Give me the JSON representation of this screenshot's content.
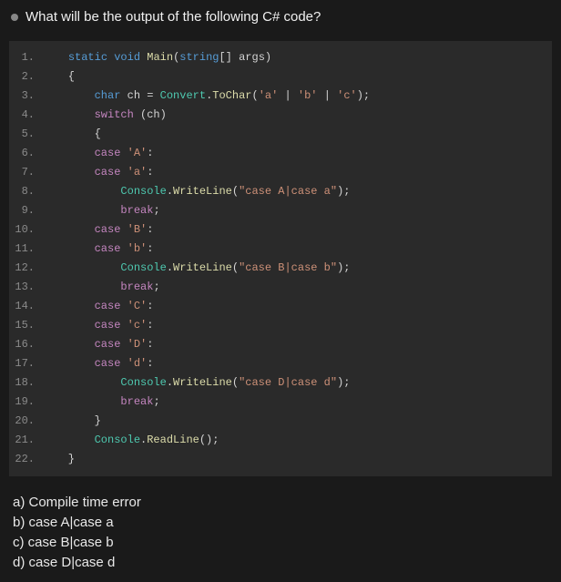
{
  "question": "What will be the output of the following C# code?",
  "code_lines": [
    {
      "n": "1.",
      "tokens": [
        {
          "t": "    "
        },
        {
          "t": "static",
          "c": "kw-mod"
        },
        {
          "t": " "
        },
        {
          "t": "void",
          "c": "kw-blue"
        },
        {
          "t": " "
        },
        {
          "t": "Main",
          "c": "fn"
        },
        {
          "t": "(",
          "c": "paren"
        },
        {
          "t": "string",
          "c": "kw-blue"
        },
        {
          "t": "[] "
        },
        {
          "t": "args",
          "c": "punct"
        },
        {
          "t": ")",
          "c": "paren"
        }
      ]
    },
    {
      "n": "2.",
      "tokens": [
        {
          "t": "    {"
        }
      ]
    },
    {
      "n": "3.",
      "tokens": [
        {
          "t": "        "
        },
        {
          "t": "char",
          "c": "kw-blue"
        },
        {
          "t": " ch = "
        },
        {
          "t": "Convert",
          "c": "type"
        },
        {
          "t": "."
        },
        {
          "t": "ToChar",
          "c": "fn"
        },
        {
          "t": "("
        },
        {
          "t": "'a'",
          "c": "str"
        },
        {
          "t": " | "
        },
        {
          "t": "'b'",
          "c": "str"
        },
        {
          "t": " | "
        },
        {
          "t": "'c'",
          "c": "str"
        },
        {
          "t": ");"
        }
      ]
    },
    {
      "n": "4.",
      "tokens": [
        {
          "t": "        "
        },
        {
          "t": "switch",
          "c": "kw-flow"
        },
        {
          "t": " (ch)"
        }
      ]
    },
    {
      "n": "5.",
      "tokens": [
        {
          "t": "        {"
        }
      ]
    },
    {
      "n": "6.",
      "tokens": [
        {
          "t": "        "
        },
        {
          "t": "case",
          "c": "kw-flow"
        },
        {
          "t": " "
        },
        {
          "t": "'A'",
          "c": "str"
        },
        {
          "t": ":"
        }
      ]
    },
    {
      "n": "7.",
      "tokens": [
        {
          "t": "        "
        },
        {
          "t": "case",
          "c": "kw-flow"
        },
        {
          "t": " "
        },
        {
          "t": "'a'",
          "c": "str"
        },
        {
          "t": ":"
        }
      ]
    },
    {
      "n": "8.",
      "tokens": [
        {
          "t": "            "
        },
        {
          "t": "Console",
          "c": "type"
        },
        {
          "t": "."
        },
        {
          "t": "WriteLine",
          "c": "fn"
        },
        {
          "t": "("
        },
        {
          "t": "\"case A|case a\"",
          "c": "str"
        },
        {
          "t": ");"
        }
      ]
    },
    {
      "n": "9.",
      "tokens": [
        {
          "t": "            "
        },
        {
          "t": "break",
          "c": "kw-flow"
        },
        {
          "t": ";"
        }
      ]
    },
    {
      "n": "10.",
      "tokens": [
        {
          "t": "        "
        },
        {
          "t": "case",
          "c": "kw-flow"
        },
        {
          "t": " "
        },
        {
          "t": "'B'",
          "c": "str"
        },
        {
          "t": ":"
        }
      ]
    },
    {
      "n": "11.",
      "tokens": [
        {
          "t": "        "
        },
        {
          "t": "case",
          "c": "kw-flow"
        },
        {
          "t": " "
        },
        {
          "t": "'b'",
          "c": "str"
        },
        {
          "t": ":"
        }
      ]
    },
    {
      "n": "12.",
      "tokens": [
        {
          "t": "            "
        },
        {
          "t": "Console",
          "c": "type"
        },
        {
          "t": "."
        },
        {
          "t": "WriteLine",
          "c": "fn"
        },
        {
          "t": "("
        },
        {
          "t": "\"case B|case b\"",
          "c": "str"
        },
        {
          "t": ");"
        }
      ]
    },
    {
      "n": "13.",
      "tokens": [
        {
          "t": "            "
        },
        {
          "t": "break",
          "c": "kw-flow"
        },
        {
          "t": ";"
        }
      ]
    },
    {
      "n": "14.",
      "tokens": [
        {
          "t": "        "
        },
        {
          "t": "case",
          "c": "kw-flow"
        },
        {
          "t": " "
        },
        {
          "t": "'C'",
          "c": "str"
        },
        {
          "t": ":"
        }
      ]
    },
    {
      "n": "15.",
      "tokens": [
        {
          "t": "        "
        },
        {
          "t": "case",
          "c": "kw-flow"
        },
        {
          "t": " "
        },
        {
          "t": "'c'",
          "c": "str"
        },
        {
          "t": ":"
        }
      ]
    },
    {
      "n": "16.",
      "tokens": [
        {
          "t": "        "
        },
        {
          "t": "case",
          "c": "kw-flow"
        },
        {
          "t": " "
        },
        {
          "t": "'D'",
          "c": "str"
        },
        {
          "t": ":"
        }
      ]
    },
    {
      "n": "17.",
      "tokens": [
        {
          "t": "        "
        },
        {
          "t": "case",
          "c": "kw-flow"
        },
        {
          "t": " "
        },
        {
          "t": "'d'",
          "c": "str"
        },
        {
          "t": ":"
        }
      ]
    },
    {
      "n": "18.",
      "tokens": [
        {
          "t": "            "
        },
        {
          "t": "Console",
          "c": "type"
        },
        {
          "t": "."
        },
        {
          "t": "WriteLine",
          "c": "fn"
        },
        {
          "t": "("
        },
        {
          "t": "\"case D|case d\"",
          "c": "str"
        },
        {
          "t": ");"
        }
      ]
    },
    {
      "n": "19.",
      "tokens": [
        {
          "t": "            "
        },
        {
          "t": "break",
          "c": "kw-flow"
        },
        {
          "t": ";"
        }
      ]
    },
    {
      "n": "20.",
      "tokens": [
        {
          "t": "        }"
        }
      ]
    },
    {
      "n": "21.",
      "tokens": [
        {
          "t": "        "
        },
        {
          "t": "Console",
          "c": "type"
        },
        {
          "t": "."
        },
        {
          "t": "ReadLine",
          "c": "fn"
        },
        {
          "t": "();"
        }
      ]
    },
    {
      "n": "22.",
      "tokens": [
        {
          "t": "    }"
        }
      ]
    }
  ],
  "options": [
    "a) Compile time error",
    "b) case A|case a",
    "c) case B|case b",
    "d) case D|case d"
  ]
}
